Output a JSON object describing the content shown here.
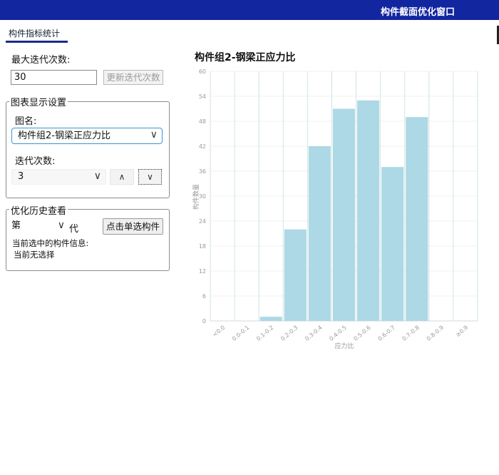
{
  "window": {
    "title": "构件截面优化窗口"
  },
  "tabs": [
    {
      "label": "构件指标统计",
      "active": true
    }
  ],
  "iteration": {
    "max_label": "最大迭代次数:",
    "max_value": "30",
    "update_button": "更新迭代次数"
  },
  "chart_settings": {
    "group_title": "图表显示设置",
    "name_label": "图名:",
    "name_value": "构件组2-钢梁正应力比",
    "iter_label": "迭代次数:",
    "iter_value": "3",
    "up_symbol": "∧",
    "down_symbol": "∨"
  },
  "history": {
    "group_title": "优化历史查看",
    "prefix": "第",
    "suffix": "代",
    "select_button": "点击单选构件",
    "info_label": "当前选中的构件信息:",
    "info_value": "当前无选择"
  },
  "icons": {
    "dropdown": "chevron-down-icon"
  },
  "colors": {
    "titlebar": "#1226a0",
    "bar": "#add8e6",
    "focus": "#3a96c9"
  },
  "chart_data": {
    "type": "bar",
    "title": "构件组2-钢梁正应力比",
    "xlabel": "应力比",
    "ylabel": "构件数量",
    "categories": [
      "<0.0",
      "0.0-0.1",
      "0.1-0.2",
      "0.2-0.3",
      "0.3-0.4",
      "0.4-0.5",
      "0.5-0.6",
      "0.6-0.7",
      "0.7-0.8",
      "0.8-0.9",
      "≥0.9"
    ],
    "values": [
      0,
      0,
      1,
      22,
      42,
      51,
      53,
      37,
      49,
      0,
      0
    ],
    "ylim": [
      0,
      60
    ],
    "yticks": [
      0,
      6,
      12,
      18,
      24,
      30,
      36,
      42,
      48,
      54,
      60
    ],
    "grid": true,
    "bar_color": "#add8e6"
  }
}
